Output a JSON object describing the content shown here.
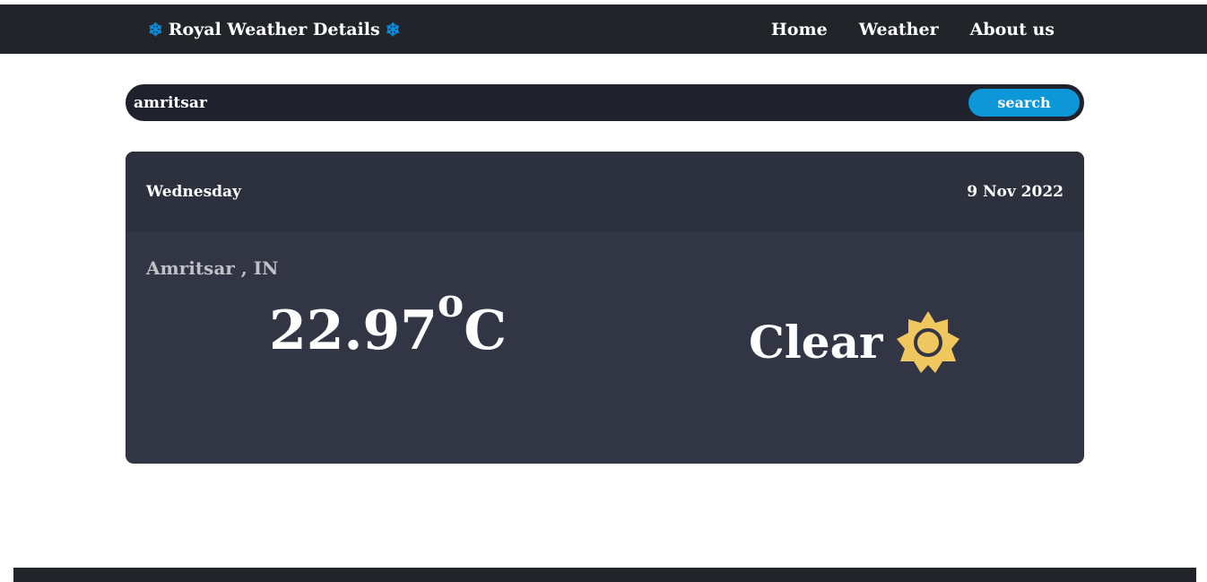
{
  "navbar": {
    "brand": "Royal Weather Details",
    "brand_icon": "snowflake-icon",
    "links": [
      "Home",
      "Weather",
      "About us"
    ]
  },
  "search": {
    "value": "amritsar",
    "button_label": "search"
  },
  "weather": {
    "day": "Wednesday",
    "date": "9 Nov 2022",
    "location": "Amritsar , IN",
    "temperature": "22.97",
    "degree_symbol": "o",
    "unit": "C",
    "condition": "Clear",
    "condition_icon": "sun-icon"
  },
  "colors": {
    "navbar": "#212529",
    "accent": "#0d96d8",
    "card": "#323544",
    "sun": "#f0c75e"
  }
}
